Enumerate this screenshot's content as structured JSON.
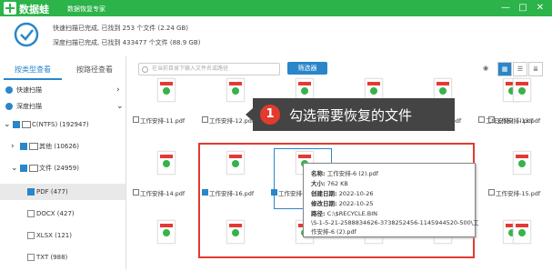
{
  "app": {
    "name": "数据蛙",
    "subtitle": "数据恢复专家"
  },
  "window": {
    "min": "—",
    "max": "□",
    "close": "✕"
  },
  "status": {
    "line1": "快速扫描已完成, 已找到 253 个文件 (2.24 GB)",
    "line2": "深度扫描已完成, 已找到 433477 个文件 (88.9 GB)"
  },
  "tabs": {
    "by_type": "按类型查看",
    "by_path": "按路径查看"
  },
  "tree": {
    "quick": "快速扫描",
    "deep": "深度扫描",
    "drive": "C(NTFS) (192947)",
    "other": "其他 (10626)",
    "docs": "文件 (24959)",
    "pdf": "PDF (477)",
    "docx": "DOCX (427)",
    "xlsx": "XLSX (121)",
    "txt": "TXT (988)"
  },
  "toolbar": {
    "search_placeholder": "在当前目录下输入文件名或路径",
    "filter": "筛选器"
  },
  "files_row1": [
    {
      "name": "工作安排-11.pdf"
    },
    {
      "name": "工作安排-12.pdf"
    },
    {
      "name": "工作安排-(...).pdf"
    },
    {
      "name": "工作安排-(...).pdf"
    },
    {
      "name": "工作安排-17.pdf"
    },
    {
      "name": "工作安排-(...).pdf"
    },
    {
      "name": "工作安排-13.pdf"
    }
  ],
  "files_row2": [
    {
      "name": "工作安排-14.pdf"
    },
    {
      "name": "工作安排-16.pdf"
    },
    {
      "name": "工作安排-(...).pdf"
    },
    {
      "name": ""
    },
    {
      "name": ""
    },
    {
      "name": ""
    },
    {
      "name": "工作安排-15.pdf"
    }
  ],
  "callout": {
    "number": "1",
    "text": "勾选需要恢复的文件"
  },
  "tooltip": {
    "name_key": "名称:",
    "name_val": "工作安排-6 (2).pdf",
    "size_key": "大小:",
    "size_val": "762 KB",
    "created_key": "创建日期:",
    "created_val": "2022-10-26",
    "modified_key": "修改日期:",
    "modified_val": "2022-10-25",
    "path_key": "路径:",
    "path_val1": "C:\\$RECYCLE.BIN",
    "path_val2": "\\S-1-5-21-2588834626-3738252456-1145944520-500\\工",
    "path_val3": "作安排-6 (2).pdf"
  },
  "colors": {
    "brand": "#2cb34a",
    "accent": "#2a86c9",
    "highlight": "#e23b2e"
  }
}
